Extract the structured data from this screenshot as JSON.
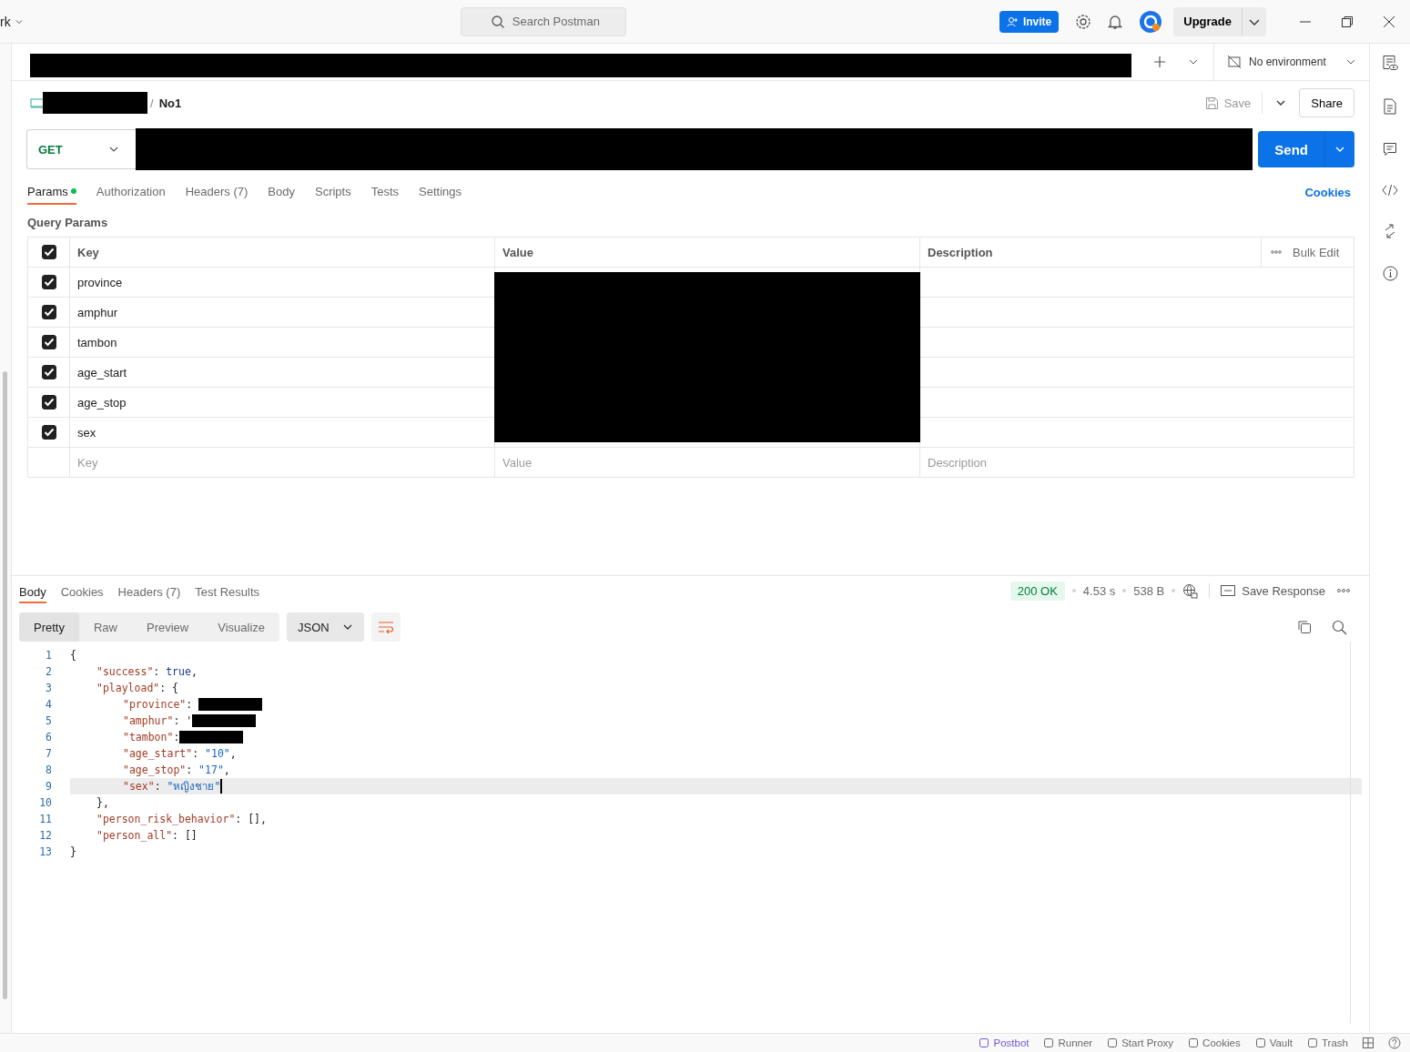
{
  "topbar": {
    "workspace": "rk",
    "search": {
      "placeholder": "Search Postman"
    },
    "invite": "Invite",
    "upgrade": "Upgrade"
  },
  "tabbar": {
    "environment": "No environment"
  },
  "request": {
    "separator": "/",
    "name": "No1",
    "save": "Save",
    "share": "Share",
    "method": "GET",
    "send": "Send",
    "tabs": [
      {
        "label": "Params",
        "selected": true,
        "dot": true
      },
      {
        "label": "Authorization",
        "selected": false,
        "dot": false
      },
      {
        "label": "Headers (7)",
        "selected": false,
        "dot": false
      },
      {
        "label": "Body",
        "selected": false,
        "dot": false
      },
      {
        "label": "Scripts",
        "selected": false,
        "dot": false
      },
      {
        "label": "Tests",
        "selected": false,
        "dot": false
      },
      {
        "label": "Settings",
        "selected": false,
        "dot": false
      }
    ],
    "cookies": "Cookies",
    "section": "Query Params",
    "columns": [
      "Key",
      "Value",
      "Description"
    ],
    "bulk_edit": "Bulk Edit",
    "all_checked": true,
    "params": [
      {
        "key": "province",
        "checked": true
      },
      {
        "key": "amphur",
        "checked": true
      },
      {
        "key": "tambon",
        "checked": true
      },
      {
        "key": "age_start",
        "checked": true
      },
      {
        "key": "age_stop",
        "checked": true
      },
      {
        "key": "sex",
        "checked": true
      }
    ],
    "new_row": {
      "key": "Key",
      "value": "Value",
      "description": "Description"
    }
  },
  "response": {
    "tabs": [
      {
        "label": "Body",
        "selected": true
      },
      {
        "label": "Cookies",
        "selected": false
      },
      {
        "label": "Headers (7)",
        "selected": false
      },
      {
        "label": "Test Results",
        "selected": false
      }
    ],
    "status": "200 OK",
    "time": "4.53 s",
    "size": "538 B",
    "save_response": "Save Response",
    "views": [
      {
        "label": "Pretty",
        "selected": true
      },
      {
        "label": "Raw",
        "selected": false
      },
      {
        "label": "Preview",
        "selected": false
      },
      {
        "label": "Visualize",
        "selected": false
      }
    ],
    "format": "JSON",
    "lines": [
      {
        "number": "1",
        "current": false,
        "tokens": [
          {
            "kind": "punct",
            "text": "{"
          }
        ],
        "children": [
          {
            "number": "2",
            "current": false,
            "tokens": [
              {
                "kind": "key",
                "text": "\"success\""
              },
              {
                "kind": "punct",
                "text": ": "
              },
              {
                "kind": "bool",
                "text": "true"
              },
              {
                "kind": "punct",
                "text": ","
              }
            ]
          },
          {
            "number": "3",
            "current": false,
            "tokens": [
              {
                "kind": "key",
                "text": "\"playload\""
              },
              {
                "kind": "punct",
                "text": ": {"
              }
            ],
            "children": [
              {
                "number": "4",
                "current": false,
                "tokens": [
                  {
                    "kind": "key",
                    "text": "\"province\""
                  },
                  {
                    "kind": "punct",
                    "text": ": "
                  },
                  {
                    "kind": "redacted"
                  }
                ]
              },
              {
                "number": "5",
                "current": false,
                "tokens": [
                  {
                    "kind": "key",
                    "text": "\"amphur\""
                  },
                  {
                    "kind": "punct",
                    "text": ": '"
                  },
                  {
                    "kind": "redacted"
                  }
                ]
              },
              {
                "number": "6",
                "current": false,
                "tokens": [
                  {
                    "kind": "key",
                    "text": "\"tambon\""
                  },
                  {
                    "kind": "punct",
                    "text": ":"
                  },
                  {
                    "kind": "redacted"
                  }
                ]
              },
              {
                "number": "7",
                "current": false,
                "tokens": [
                  {
                    "kind": "key",
                    "text": "\"age_start\""
                  },
                  {
                    "kind": "punct",
                    "text": ": "
                  },
                  {
                    "kind": "string",
                    "text": "\"10\""
                  },
                  {
                    "kind": "punct",
                    "text": ","
                  }
                ]
              },
              {
                "number": "8",
                "current": false,
                "tokens": [
                  {
                    "kind": "key",
                    "text": "\"age_stop\""
                  },
                  {
                    "kind": "punct",
                    "text": ": "
                  },
                  {
                    "kind": "string",
                    "text": "\"17\""
                  },
                  {
                    "kind": "punct",
                    "text": ","
                  }
                ]
              },
              {
                "number": "9",
                "current": true,
                "tokens": [
                  {
                    "kind": "key",
                    "text": "\"sex\""
                  },
                  {
                    "kind": "punct",
                    "text": ": "
                  },
                  {
                    "kind": "string",
                    "text": "\"หญิงชาย\""
                  }
                ]
              }
            ]
          },
          {
            "number": "10",
            "current": false,
            "tokens": [
              {
                "kind": "punct",
                "text": "},"
              }
            ]
          },
          {
            "number": "11",
            "current": false,
            "tokens": [
              {
                "kind": "key",
                "text": "\"person_risk_behavior\""
              },
              {
                "kind": "punct",
                "text": ": [],"
              }
            ]
          },
          {
            "number": "12",
            "current": false,
            "tokens": [
              {
                "kind": "key",
                "text": "\"person_all\""
              },
              {
                "kind": "punct",
                "text": ": []"
              }
            ]
          }
        ]
      },
      {
        "number": "13",
        "current": false,
        "tokens": [
          {
            "kind": "punct",
            "text": "}"
          }
        ]
      }
    ]
  },
  "statusbar": [
    "Postbot",
    "Runner",
    "Start Proxy",
    "Cookies",
    "Vault",
    "Trash"
  ]
}
